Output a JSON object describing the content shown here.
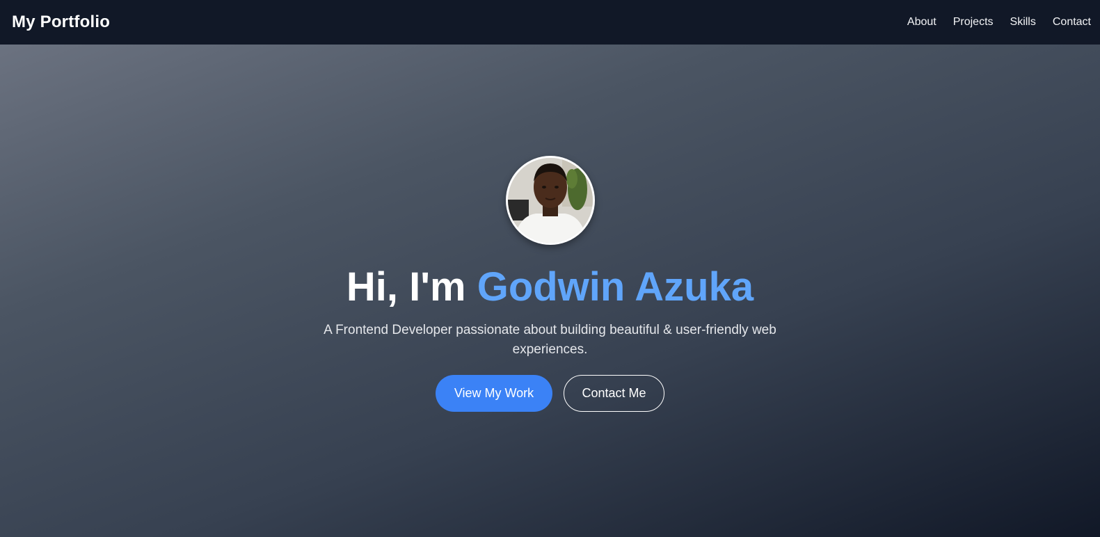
{
  "navbar": {
    "brand": "My Portfolio",
    "links": [
      "About",
      "Projects",
      "Skills",
      "Contact"
    ]
  },
  "hero": {
    "greeting": "Hi, I'm ",
    "name": "Godwin Azuka",
    "tagline": "A Frontend Developer passionate about building beautiful & user-friendly web experiences.",
    "primary_button": "View My Work",
    "secondary_button": "Contact Me"
  },
  "colors": {
    "navbar_bg": "#111827",
    "accent_name": "#60a5fa",
    "primary_button_bg": "#3b82f6"
  }
}
